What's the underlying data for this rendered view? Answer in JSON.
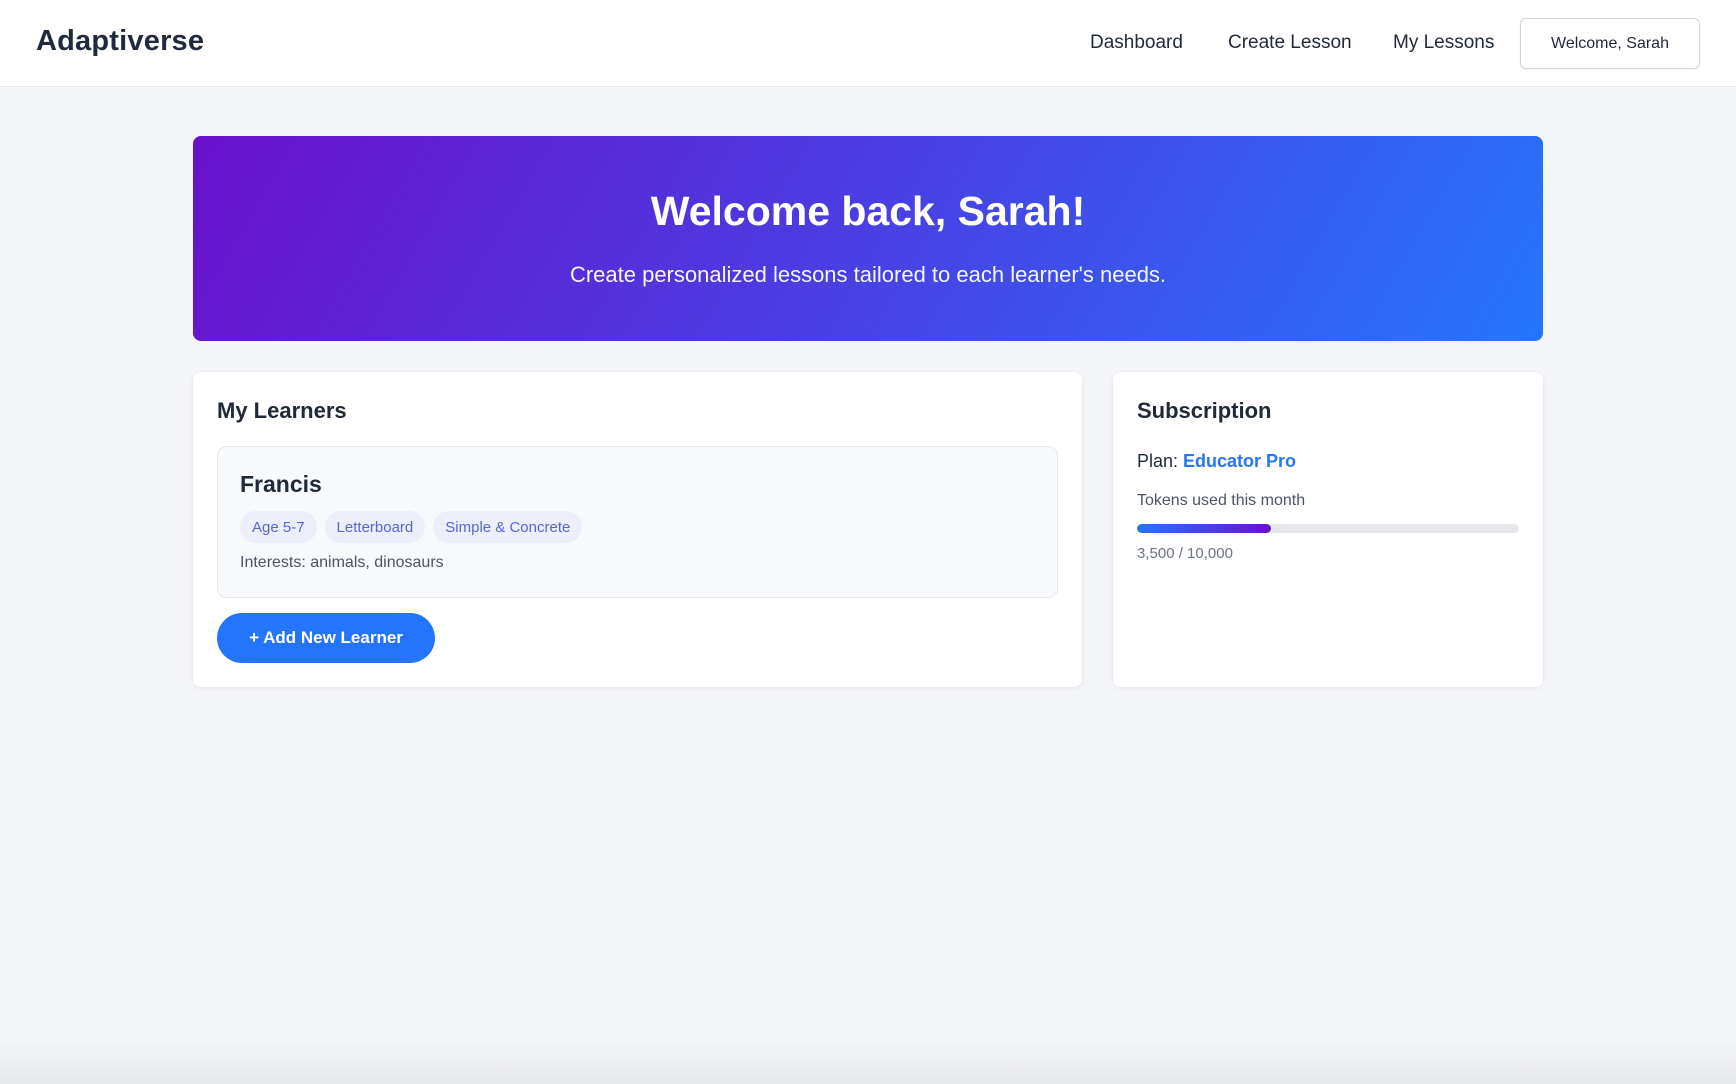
{
  "header": {
    "brand": "Adaptiverse",
    "nav": {
      "dashboard": "Dashboard",
      "create_lesson": "Create Lesson",
      "my_lessons": "My Lessons"
    },
    "user_button": "Welcome, Sarah"
  },
  "hero": {
    "title": "Welcome back, Sarah!",
    "subtitle": "Create personalized lessons tailored to each learner's needs."
  },
  "learners": {
    "title": "My Learners",
    "items": [
      {
        "name": "Francis",
        "tags": [
          "Age 5-7",
          "Letterboard",
          "Simple & Concrete"
        ],
        "interests": "Interests: animals, dinosaurs"
      }
    ],
    "add_button": "+ Add New Learner"
  },
  "subscription": {
    "title": "Subscription",
    "plan_label": "Plan: ",
    "plan_name": "Educator Pro",
    "tokens_label": "Tokens used this month",
    "tokens_used": 3500,
    "tokens_total": 10000,
    "tokens_text": "3,500 / 10,000"
  },
  "colors": {
    "accent": "#2575fc",
    "gradient_start": "#6a11cb",
    "gradient_end": "#2575fc",
    "tag_bg": "#eceef9",
    "tag_text": "#5866d4"
  }
}
